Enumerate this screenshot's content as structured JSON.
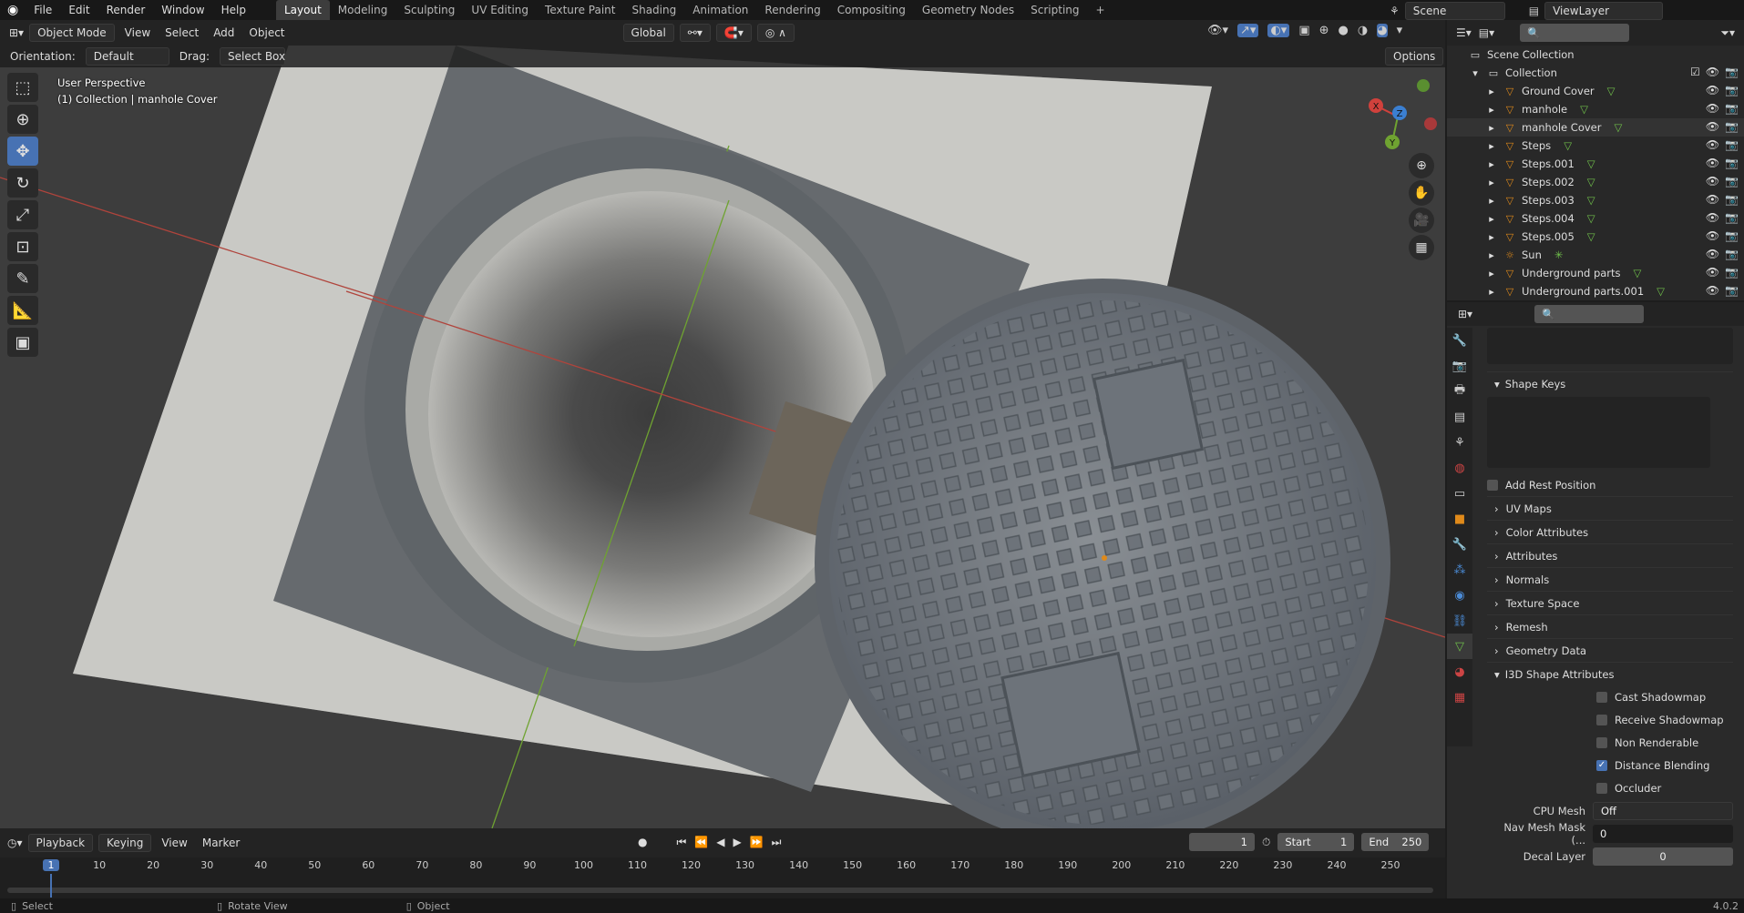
{
  "topbar": {
    "menus": [
      "File",
      "Edit",
      "Render",
      "Window",
      "Help"
    ],
    "workspaces": [
      "Layout",
      "Modeling",
      "Sculpting",
      "UV Editing",
      "Texture Paint",
      "Shading",
      "Animation",
      "Rendering",
      "Compositing",
      "Geometry Nodes",
      "Scripting"
    ],
    "active_workspace": "Layout",
    "scene": "Scene",
    "view_layer": "ViewLayer"
  },
  "header": {
    "mode": "Object Mode",
    "menus": [
      "View",
      "Select",
      "Add",
      "Object"
    ],
    "transform": "Global",
    "options": "Options",
    "orientation_label": "Orientation:",
    "orientation_value": "Default",
    "drag_label": "Drag:",
    "drag_value": "Select Box"
  },
  "viewport": {
    "perspective": "User Perspective",
    "collection_info": "(1) Collection | manhole Cover",
    "gizmo": {
      "x": "X",
      "y": "Y",
      "z": "Z"
    }
  },
  "outliner": {
    "scene_collection": "Scene Collection",
    "collection": "Collection",
    "items": [
      {
        "name": "Ground Cover",
        "type": "mesh"
      },
      {
        "name": "manhole",
        "type": "mesh"
      },
      {
        "name": "manhole Cover",
        "type": "mesh",
        "selected": true
      },
      {
        "name": "Steps",
        "type": "mesh"
      },
      {
        "name": "Steps.001",
        "type": "mesh"
      },
      {
        "name": "Steps.002",
        "type": "mesh"
      },
      {
        "name": "Steps.003",
        "type": "mesh"
      },
      {
        "name": "Steps.004",
        "type": "mesh"
      },
      {
        "name": "Steps.005",
        "type": "mesh"
      },
      {
        "name": "Sun",
        "type": "light"
      },
      {
        "name": "Underground parts",
        "type": "mesh"
      },
      {
        "name": "Underground parts.001",
        "type": "mesh"
      }
    ]
  },
  "properties": {
    "shape_keys": "Shape Keys",
    "add_rest_position": "Add Rest Position",
    "sections": [
      "UV Maps",
      "Color Attributes",
      "Attributes",
      "Normals",
      "Texture Space",
      "Remesh",
      "Geometry Data"
    ],
    "i3d_section": "I3D Shape Attributes",
    "i3d_checks": [
      {
        "label": "Cast Shadowmap",
        "checked": false
      },
      {
        "label": "Receive Shadowmap",
        "checked": false
      },
      {
        "label": "Non Renderable",
        "checked": false
      },
      {
        "label": "Distance Blending",
        "checked": true
      },
      {
        "label": "Occluder",
        "checked": false
      }
    ],
    "cpu_mesh_label": "CPU Mesh",
    "cpu_mesh_value": "Off",
    "nav_mesh_label": "Nav Mesh Mask (...",
    "nav_mesh_value": "0",
    "decal_label": "Decal Layer",
    "decal_value": "0"
  },
  "timeline": {
    "menus": [
      "Playback",
      "Keying",
      "View",
      "Marker"
    ],
    "current_frame": "1",
    "start_label": "Start",
    "start": "1",
    "end_label": "End",
    "end": "250",
    "ticks": [
      "1",
      "10",
      "20",
      "30",
      "40",
      "50",
      "60",
      "70",
      "80",
      "90",
      "100",
      "110",
      "120",
      "130",
      "140",
      "150",
      "160",
      "170",
      "180",
      "190",
      "200",
      "210",
      "220",
      "230",
      "240",
      "250"
    ]
  },
  "status": {
    "select": "Select",
    "rotate": "Rotate View",
    "object": "Object",
    "version": "4.0.2"
  }
}
